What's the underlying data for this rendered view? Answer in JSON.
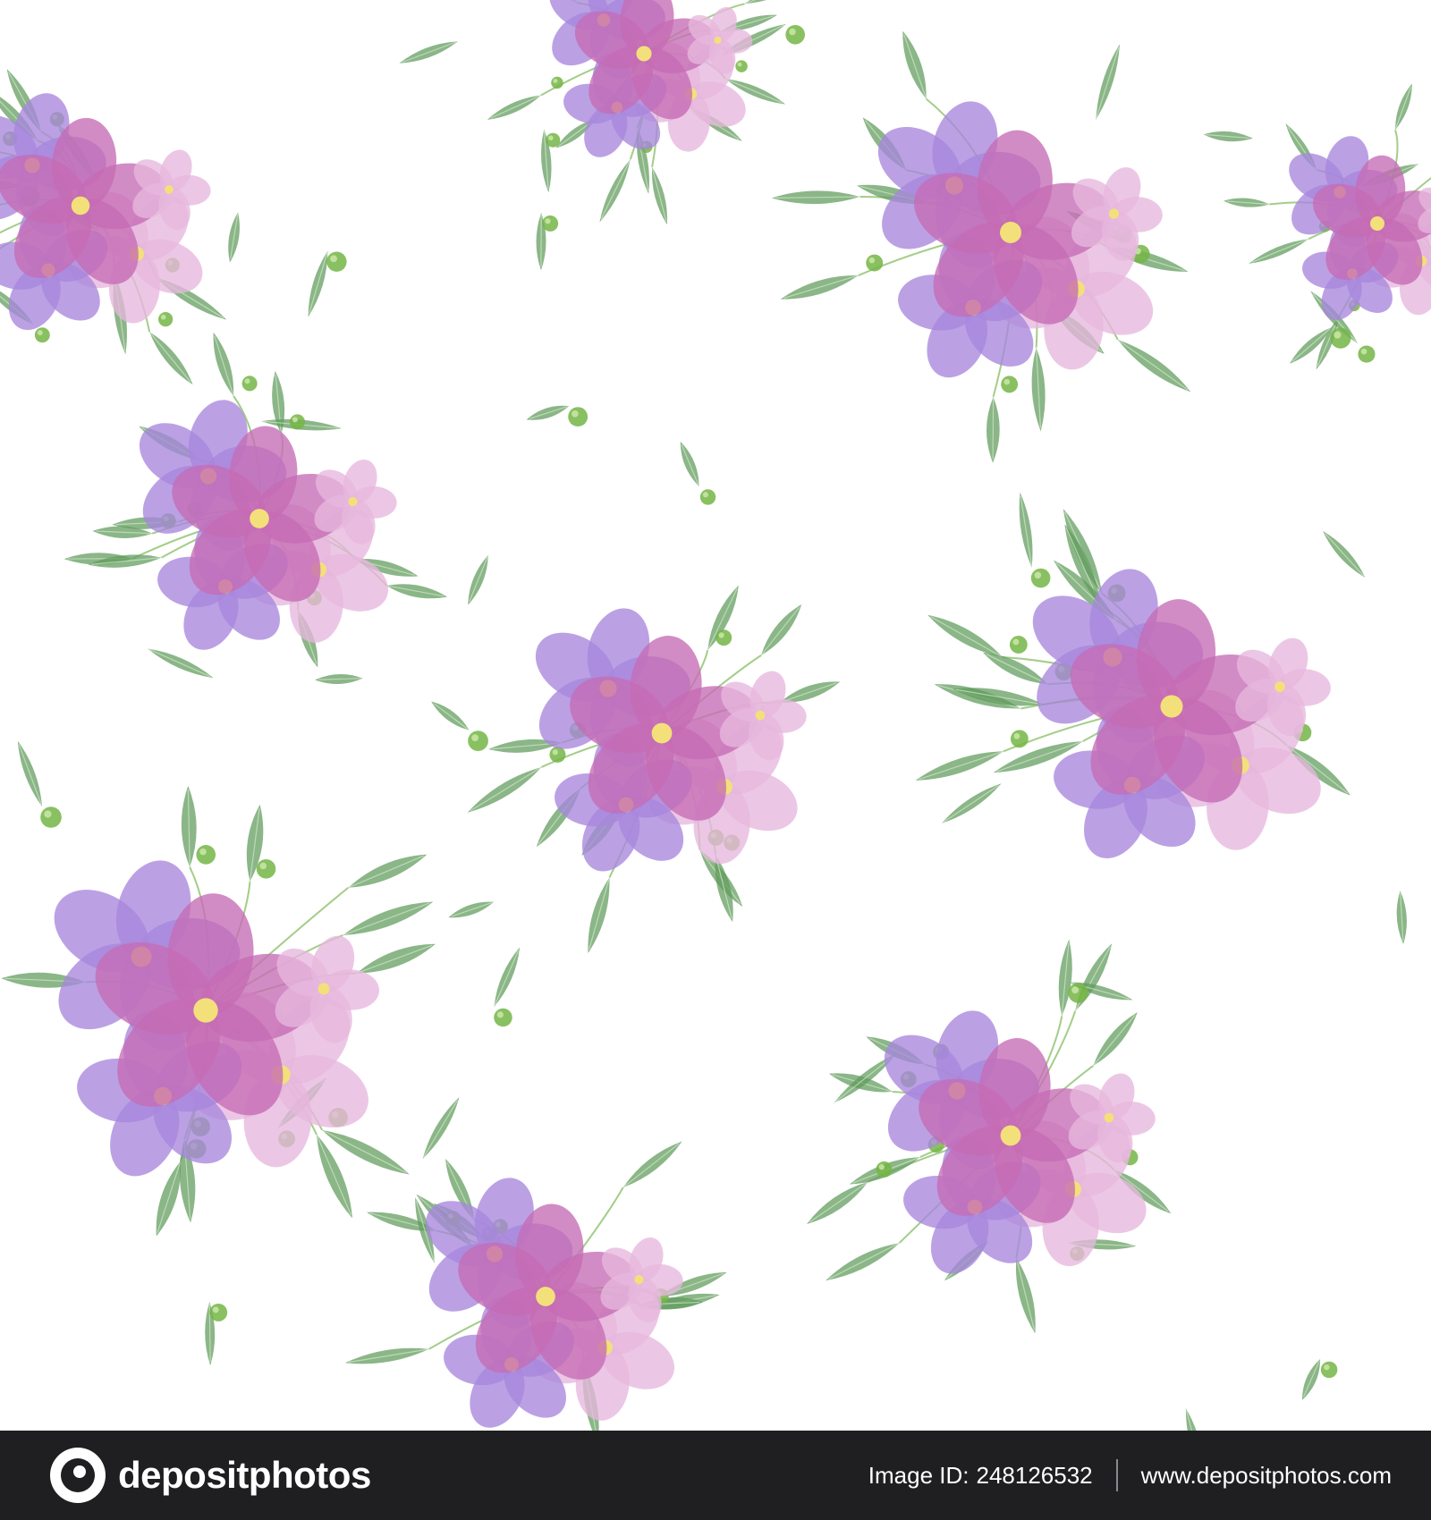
{
  "image": {
    "subject": "watercolor-floral-pattern",
    "colors": {
      "background": "#ffffff",
      "petal_pink": "#c56bb5",
      "petal_violet": "#a886dc",
      "petal_light": "#e7b7de",
      "leaf": "#5e9a5a",
      "berry": "#74b545",
      "center": "#f3e07a",
      "footer": "#1f1f22"
    }
  },
  "footer": {
    "brand_name": "depositphotos",
    "brand_icon": "depositphotos-logo-icon",
    "image_id_label": "Image ID:",
    "image_id": "248126532",
    "website": "www.depositphotos.com"
  }
}
